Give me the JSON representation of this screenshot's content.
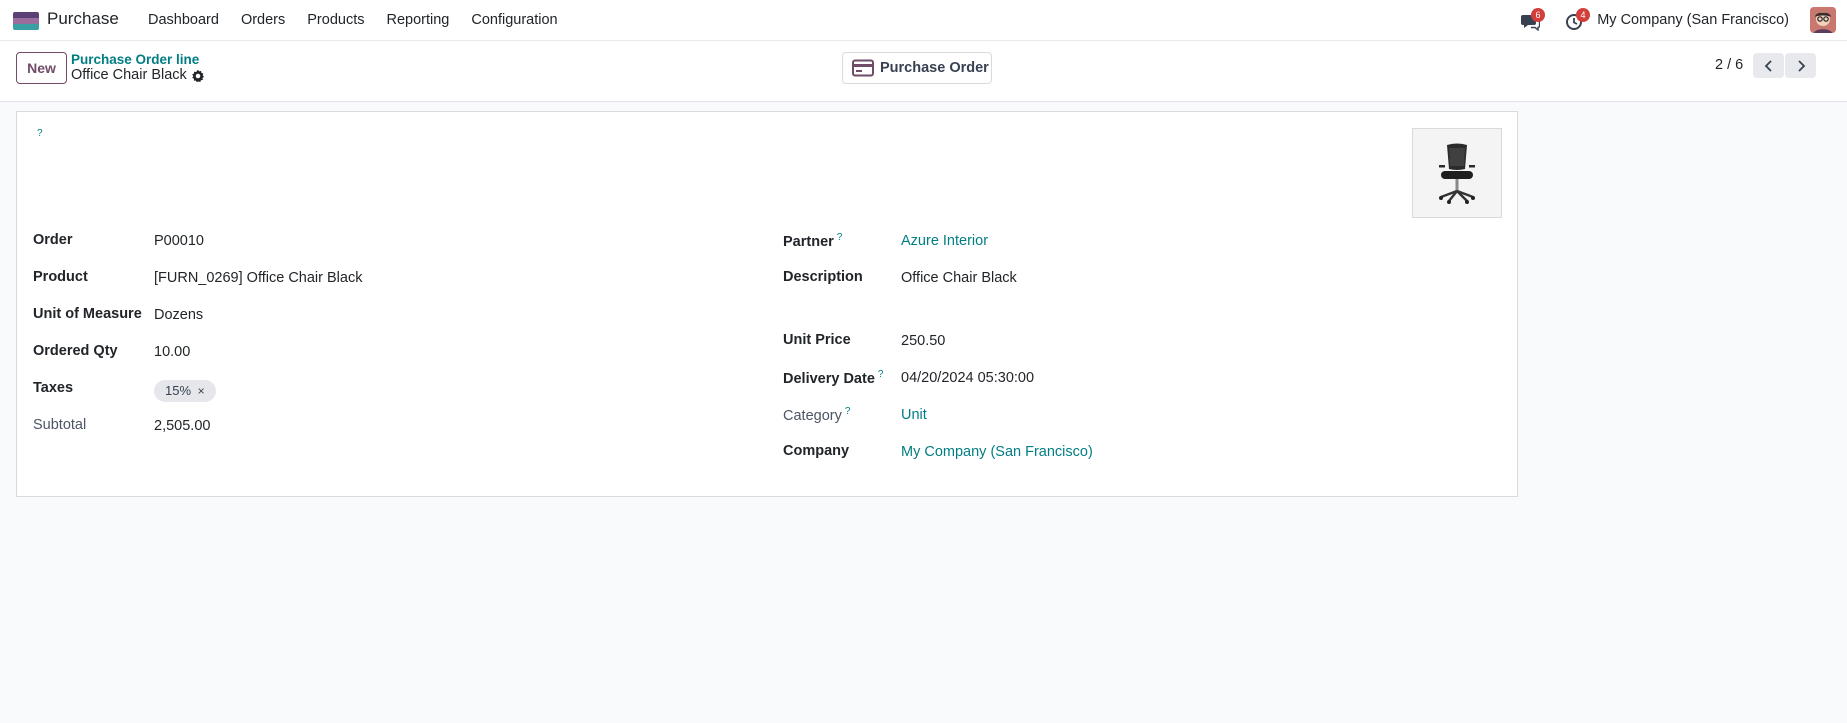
{
  "navbar": {
    "app_name": "Purchase",
    "menu": [
      "Dashboard",
      "Orders",
      "Products",
      "Reporting",
      "Configuration"
    ],
    "messages_count": "6",
    "activities_count": "4",
    "company": "My Company (San Francisco)"
  },
  "control_panel": {
    "new_label": "New",
    "breadcrumb_parent": "Purchase Order line",
    "breadcrumb_current": "Office Chair Black",
    "purchase_order_button": "Purchase Order",
    "pager": "2 / 6"
  },
  "form": {
    "help_marker": "?",
    "left": {
      "order_label": "Order",
      "order_value": "P00010",
      "product_label": "Product",
      "product_value": "[FURN_0269] Office Chair Black",
      "uom_label": "Unit of Measure",
      "uom_value": "Dozens",
      "qty_label": "Ordered Qty",
      "qty_value": "10.00",
      "taxes_label": "Taxes",
      "tax_tag": "15%",
      "subtotal_label": "Subtotal",
      "subtotal_value": "2,505.00"
    },
    "right": {
      "partner_label": "Partner",
      "partner_value": "Azure Interior",
      "description_label": "Description",
      "description_value": "Office Chair Black",
      "unit_price_label": "Unit Price",
      "unit_price_value": "250.50",
      "delivery_date_label": "Delivery Date",
      "delivery_date_value": "04/20/2024 05:30:00",
      "category_label": "Category",
      "category_value": "Unit",
      "company_label": "Company",
      "company_value": "My Company (San Francisco)"
    }
  },
  "colors": {
    "brand": "#714b67",
    "link": "#017e84",
    "badge": "#d23f3a"
  }
}
